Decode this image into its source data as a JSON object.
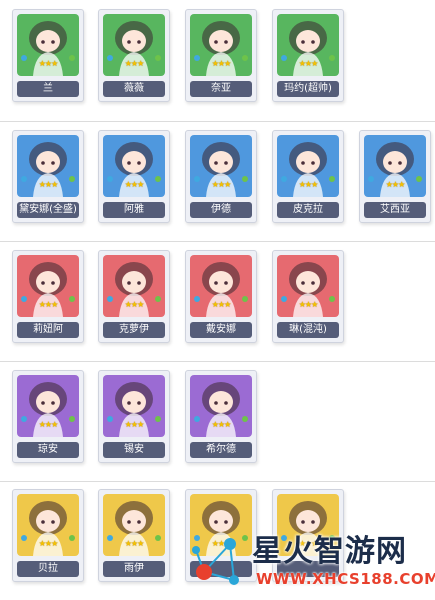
{
  "colors": {
    "green": "#58b65f",
    "blue": "#4f98de",
    "red": "#e66a70",
    "purple": "#9b6bd3",
    "yellow": "#efc84a",
    "name_plate": "#555d79",
    "watermark_url": "#e8402d"
  },
  "groups": [
    {
      "rarity_color": "green",
      "characters": [
        {
          "name": "兰"
        },
        {
          "name": "薇薇"
        },
        {
          "name": "奈亚"
        },
        {
          "name": "玛约(超帅)"
        }
      ]
    },
    {
      "rarity_color": "blue",
      "characters": [
        {
          "name": "黛安娜(全盛)"
        },
        {
          "name": "阿雅"
        },
        {
          "name": "伊德"
        },
        {
          "name": "皮克拉"
        },
        {
          "name": "艾西亚"
        }
      ]
    },
    {
      "rarity_color": "red",
      "characters": [
        {
          "name": "莉妞阿"
        },
        {
          "name": "克萝伊"
        },
        {
          "name": "戴安娜"
        },
        {
          "name": "琳(混沌)"
        }
      ]
    },
    {
      "rarity_color": "purple",
      "characters": [
        {
          "name": "琼安"
        },
        {
          "name": "锡安"
        },
        {
          "name": "希尔德"
        }
      ]
    },
    {
      "rarity_color": "yellow",
      "characters": [
        {
          "name": "贝拉"
        },
        {
          "name": "雨伊"
        },
        {
          "name": ""
        },
        {
          "name": ""
        }
      ]
    }
  ],
  "stars_text": "★★★",
  "watermark": {
    "title": "星火智游网",
    "url": "WWW.XHCS188.COM"
  }
}
